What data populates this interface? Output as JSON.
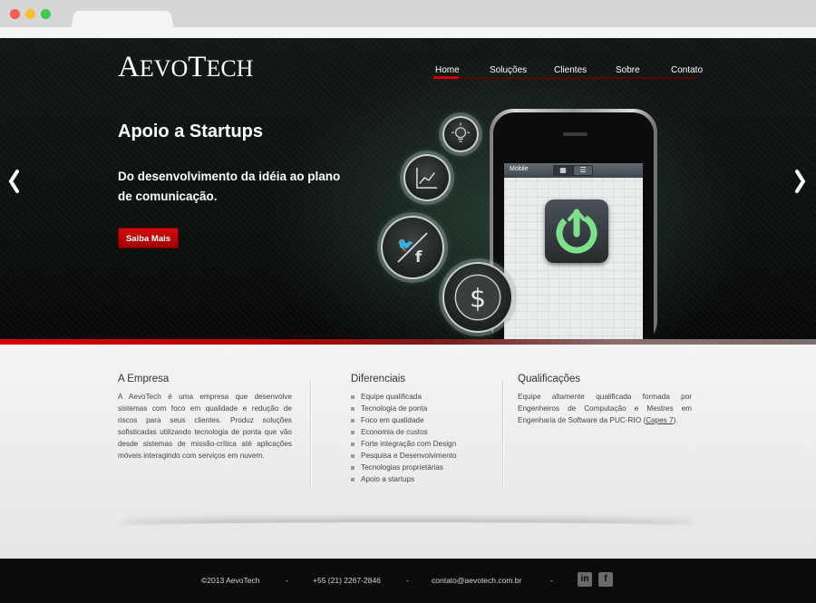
{
  "colors": {
    "accent": "#d60000",
    "hero_bg": "#0c100e",
    "footer_bg": "#0b0b0b",
    "content_bg": "#ececec"
  },
  "brand": {
    "logo_text_a": "A",
    "logo_text_b": "EVO",
    "logo_text_c": "T",
    "logo_text_d": "ECH"
  },
  "nav": {
    "items": [
      {
        "label": "Home",
        "active": true
      },
      {
        "label": "Soluções"
      },
      {
        "label": "Clientes"
      },
      {
        "label": "Sobre"
      },
      {
        "label": "Contato"
      }
    ]
  },
  "hero": {
    "title": "Apoio a Startups",
    "subtitle": "Do desenvolvimento da idéia ao plano de comunicação.",
    "cta_label": "Saiba Mais",
    "prev_icon": "chevron-left-icon",
    "next_icon": "chevron-right-icon",
    "phone": {
      "status_label": "Mobile",
      "seg_icons": [
        "grid-icon",
        "list-icon"
      ]
    },
    "bubble_icons": [
      "lightbulb-icon",
      "chart-icon",
      "twitter-facebook-icon",
      "dollar-icon"
    ]
  },
  "columns": {
    "empresa": {
      "title": "A Empresa",
      "text": "A AevoTech é uma empresa que desenvolve sistemas com foco em qualidade e redução de riscos para seus clientes. Produz soluções sofisticadas utilizando tecnologia de ponta que vão desde sistemas de missão-crítica até aplicações móveis interagindo com serviços em nuvem."
    },
    "diferenciais": {
      "title": "Diferenciais",
      "items": [
        "Equipe qualificada",
        "Tecnologia de ponta",
        "Foco em qualidade",
        "Economia de custos",
        "Forte integração com Design",
        "Pesquisa e Desenvolvimento",
        "Tecnologias proprietárias",
        "Apoio a startups"
      ]
    },
    "qualificacoes": {
      "title": "Qualificações",
      "text": "Equipe altamente qualificada formada por Engenheiros de Computação e Mestres em Engenharia de Software da PUC-RIO (",
      "link": "Capes 7",
      "text_end": ")."
    }
  },
  "footer": {
    "copyright": "©2013 AevoTech",
    "phone": "+55 (21) 2267-2846",
    "email": "contato@aevotech.com.br",
    "separator": "-",
    "social": [
      {
        "label": "in",
        "icon": "linkedin-icon"
      },
      {
        "label": "f",
        "icon": "facebook-icon"
      }
    ]
  }
}
